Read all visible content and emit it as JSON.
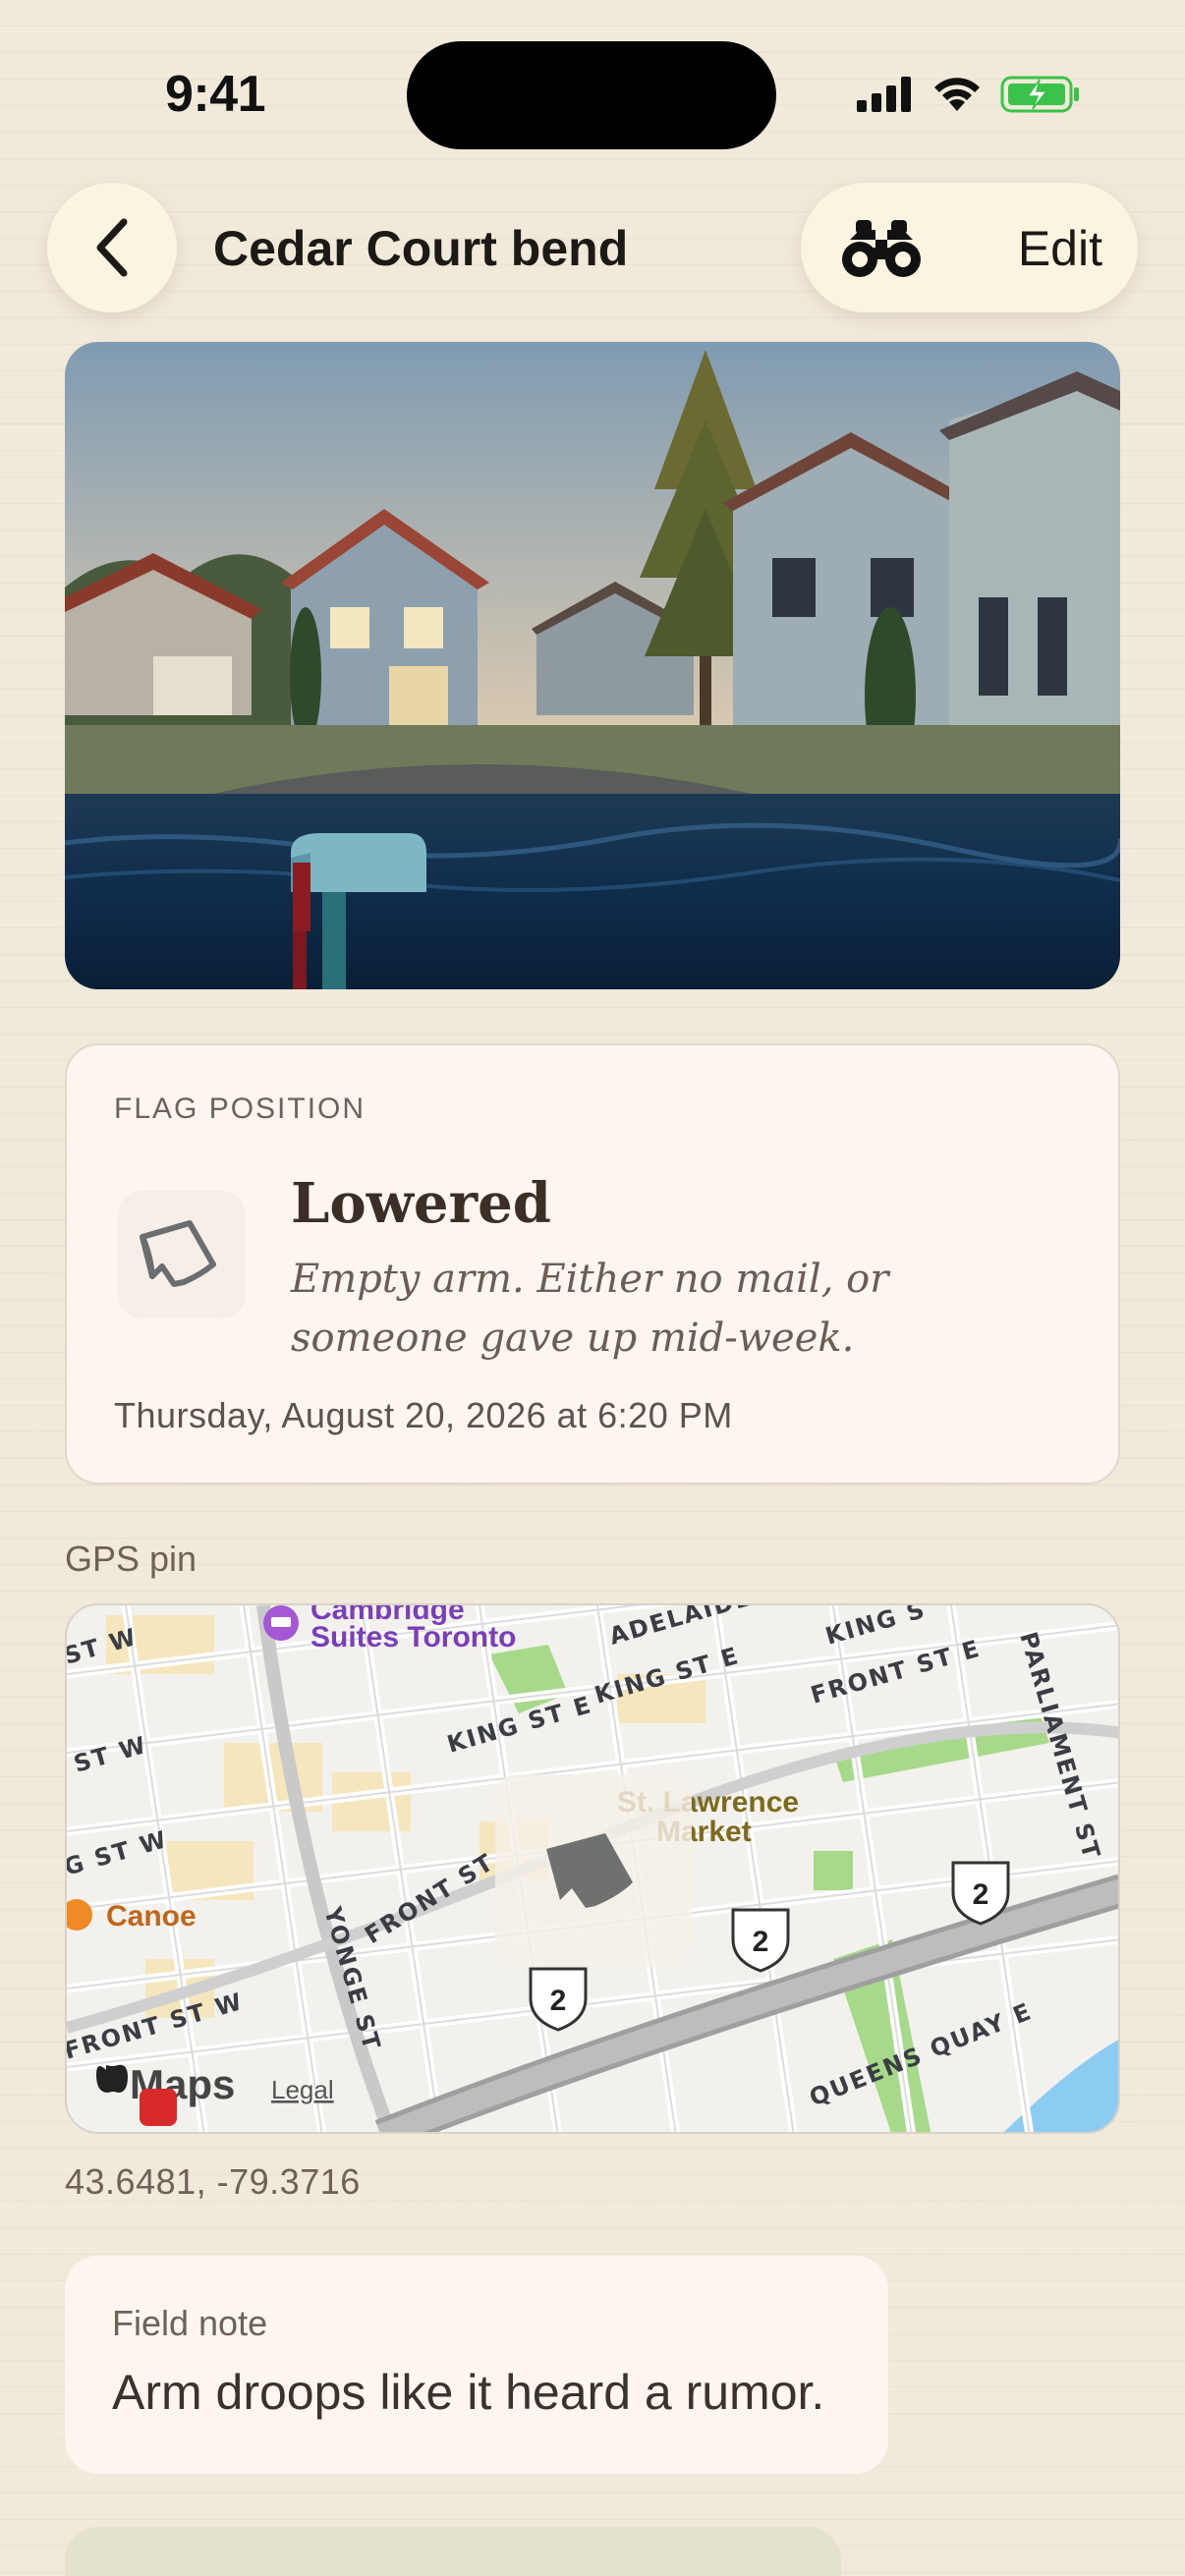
{
  "status_bar": {
    "time": "9:41"
  },
  "header": {
    "title": "Cedar Court bend",
    "edit_label": "Edit"
  },
  "flag": {
    "caption": "FLAG POSITION",
    "state": "Lowered",
    "description": "Empty arm. Either no mail, or someone gave up mid-week.",
    "timestamp": "Thursday, August 20, 2026 at 6:20 PM"
  },
  "gps": {
    "label": "GPS pin",
    "coordinates": "43.6481, -79.3716",
    "map": {
      "attribution": "Maps",
      "legal": "Legal",
      "pois": [
        "Cambridge",
        "Suites Toronto",
        "St. Lawrence",
        "Market",
        "Canoe"
      ],
      "streets": [
        "ADELAIDE",
        "KING ST E",
        "KING ST E",
        "KING S",
        "FRONT ST E",
        "PARLIAMENT ST",
        "ST W",
        "ST W",
        "G ST W",
        "FRONT ST",
        "FRONT ST W",
        "YONGE ST",
        "QUEENS QUAY E"
      ],
      "highway_shield": "2"
    }
  },
  "note": {
    "label": "Field note",
    "text": "Arm droops like it heard a rumor."
  },
  "colors": {
    "background": "#f1e9da",
    "card": "#fdf5f0",
    "pill": "#fbf4e1",
    "battery": "#3bc24a"
  }
}
